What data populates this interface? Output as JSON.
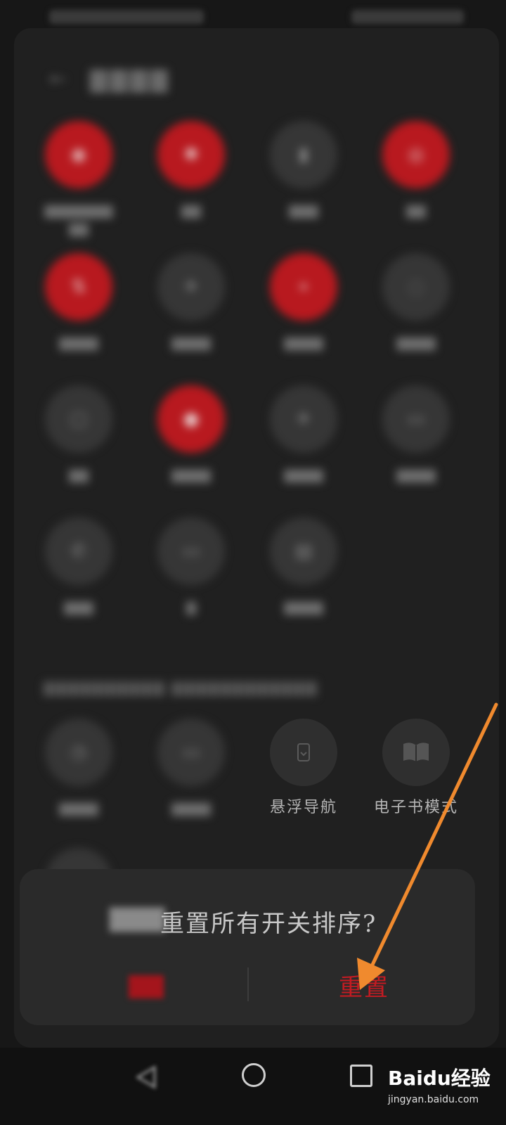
{
  "header": {
    "back_icon": "back-arrow-icon"
  },
  "tiles_visible": [
    {
      "label": "悬浮导航",
      "icon": "floating-nav-icon"
    },
    {
      "label": "电子书模式",
      "icon": "book-icon"
    }
  ],
  "dialog": {
    "title": "重置所有开关排序?",
    "reset_label": "重置"
  },
  "nav": {
    "back_icon": "nav-back-icon",
    "home_icon": "nav-home-icon",
    "recent_icon": "nav-recent-icon"
  },
  "watermark": {
    "brand": "Baidu经验",
    "url": "jingyan.baidu.com"
  },
  "colors": {
    "accent": "#c41b22",
    "arrow": "#f08a2e",
    "background": "#171717"
  }
}
